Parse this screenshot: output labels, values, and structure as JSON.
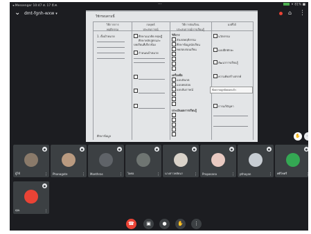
{
  "status_bar": {
    "left": "◂ Messenger  10:47  ส. 17 มี.ค.",
    "center": "···",
    "right": "✦ 81% ■"
  },
  "meeting": {
    "code": "dmt-fgnh-wxw",
    "dropdown_icon": "chevron-down-icon",
    "back_icon": "chevron-down-icon",
    "recording_color": "#ea4335",
    "pin_icon": "pin-icon",
    "more_icon": "more-vert-icon"
  },
  "shared_document": {
    "title": "ใช้กรอบตามนี้",
    "columns": [
      "วิธีการการ",
      "กลยุทธ์",
      "วิธีการจัดเรียน",
      "ผลที่ได้"
    ],
    "col_subheads": [
      "พฤติกรรม",
      "ประสบการณ์",
      "ประสบการณ์การเรียนรู้",
      ""
    ],
    "col1_item": "1. ตั้งเป้าหมาย",
    "col1_bottom": "ศึกษาข้อมูล",
    "col2_items": [
      "ศึกษาแนวคิด ทฤษฎี",
      "ศึกษาหลักสูตรและ",
      "บทเรียนที่เกี่ยวข้อง",
      "กำหนดเป้าหมาย"
    ],
    "col3_sections": [
      "วิธีการ",
      "เครื่องมือ",
      "ประเมินผลการเรียนรู้"
    ],
    "col3_items": [
      "สังเกตพฤติกรรม",
      "ศึกษาข้อมูลนักเรียน",
      "ทดสอบก่อนเรียน",
      "แบบสังเกต",
      "แบบทดสอบ",
      "แบบสัมภาษณ์"
    ],
    "col4_items": [
      "นวัตกรรม",
      "แบบฝึกทักษะ",
      "พัฒนาการเรียนรู้",
      "ความคิดสร้างสรรค์",
      "การแก้ปัญหา"
    ],
    "tooltip": "ข้อความถูกคัดลอกแล้ว"
  },
  "side_buttons": [
    "hand-icon",
    "more-horiz-icon"
  ],
  "participants": [
    {
      "name": "ผู้ใช้",
      "accent": "#8a7a6a"
    },
    {
      "name": "Phanagate",
      "accent": "#b99a80"
    },
    {
      "name": "Monthras",
      "accent": "#5f6368"
    },
    {
      "name": "ไอศอ",
      "accent": "#6f7572"
    },
    {
      "name": "นางสาวพลัยนา",
      "accent": "#d9d2c9"
    },
    {
      "name": "Prapasana",
      "accent": "#e8c9c1"
    },
    {
      "name": "pthayan",
      "accent": "#c7cdd3"
    },
    {
      "name": "ศศิไพศรี",
      "accent": "#34a853"
    },
    {
      "name": "คุณ",
      "accent": "#ea4335"
    }
  ],
  "controls": {
    "end_call_color": "#ea4335",
    "buttons": [
      "end-call-icon",
      "camera-icon",
      "microphone-icon",
      "raise-hand-icon",
      "more-options-icon"
    ]
  }
}
